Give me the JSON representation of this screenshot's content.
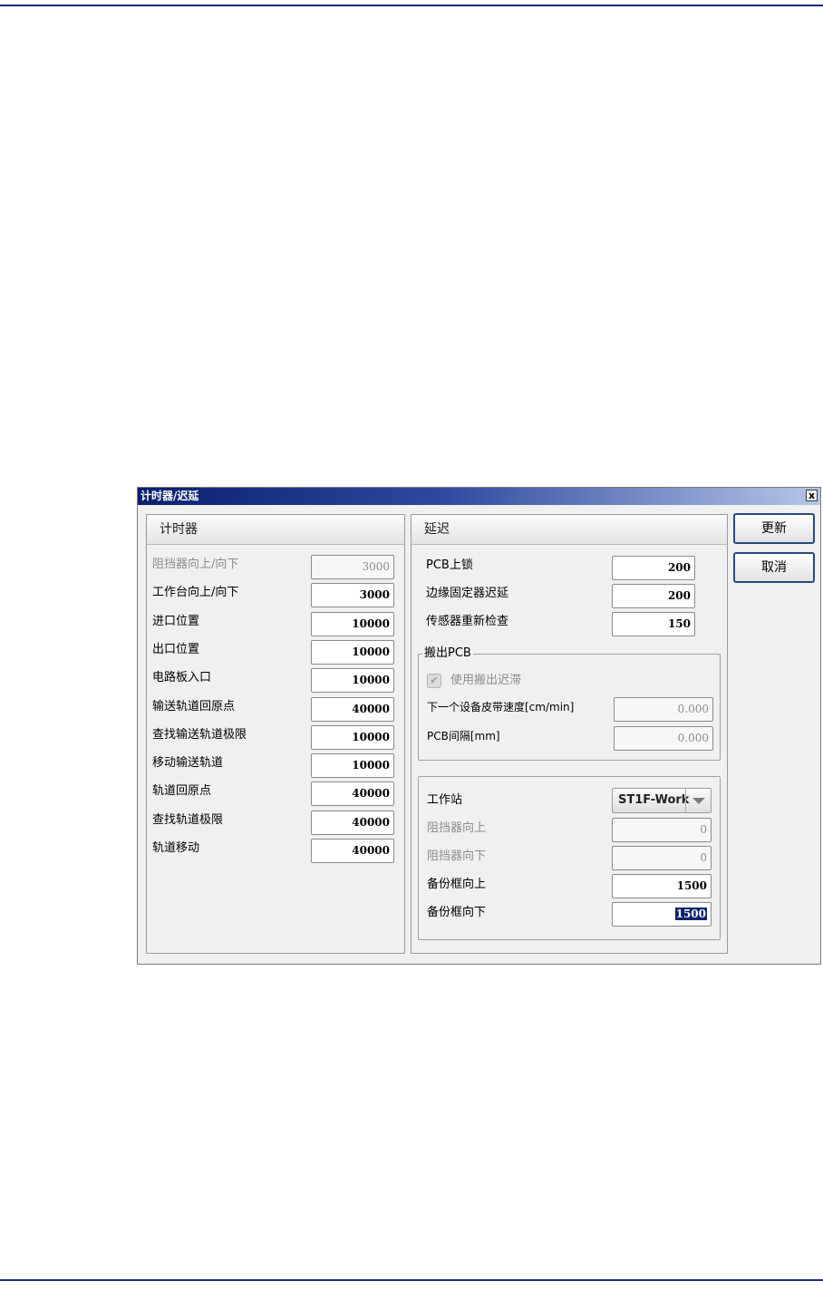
{
  "dialog": {
    "title": "计时器/迟延",
    "close_glyph": "x"
  },
  "timers": {
    "header": "计时器",
    "rows": [
      {
        "label": "阻挡器向上/向下",
        "value": "3000",
        "disabled": true
      },
      {
        "label": "工作台向上/向下",
        "value": "3000",
        "disabled": false
      },
      {
        "label": "进口位置",
        "value": "10000",
        "disabled": false
      },
      {
        "label": "出口位置",
        "value": "10000",
        "disabled": false
      },
      {
        "label": "电路板入口",
        "value": "10000",
        "disabled": false
      },
      {
        "label": "输送轨道回原点",
        "value": "40000",
        "disabled": false
      },
      {
        "label": "查找输送轨道极限",
        "value": "10000",
        "disabled": false
      },
      {
        "label": "移动输送轨道",
        "value": "10000",
        "disabled": false
      },
      {
        "label": "轨道回原点",
        "value": "40000",
        "disabled": false
      },
      {
        "label": "查找轨道极限",
        "value": "40000",
        "disabled": false
      },
      {
        "label": "轨道移动",
        "value": "40000",
        "disabled": false
      }
    ]
  },
  "delays": {
    "header": "延迟",
    "rows": [
      {
        "label": "PCB上锁",
        "value": "200"
      },
      {
        "label": "边缘固定器迟延",
        "value": "200"
      },
      {
        "label": "传感器重新检查",
        "value": "150"
      }
    ],
    "unload": {
      "group_label": "搬出PCB",
      "checkbox_label": "使用搬出迟滞",
      "checkbox_checked": true,
      "conveyor_speed_label": "下一个设备皮带速度[cm/min]",
      "conveyor_speed_value": "0.000",
      "pcb_gap_label": "PCB间隔[mm]",
      "pcb_gap_value": "0.000"
    },
    "station": {
      "station_label": "工作站",
      "station_value": "ST1F-Work",
      "stopper_up_label": "阻挡器向上",
      "stopper_up_value": "0",
      "stopper_down_label": "阻挡器向下",
      "stopper_down_value": "0",
      "backup_up_label": "备份框向上",
      "backup_up_value": "1500",
      "backup_down_label": "备份框向下",
      "backup_down_value": "1500"
    }
  },
  "buttons": {
    "update": "更新",
    "cancel": "取消"
  }
}
